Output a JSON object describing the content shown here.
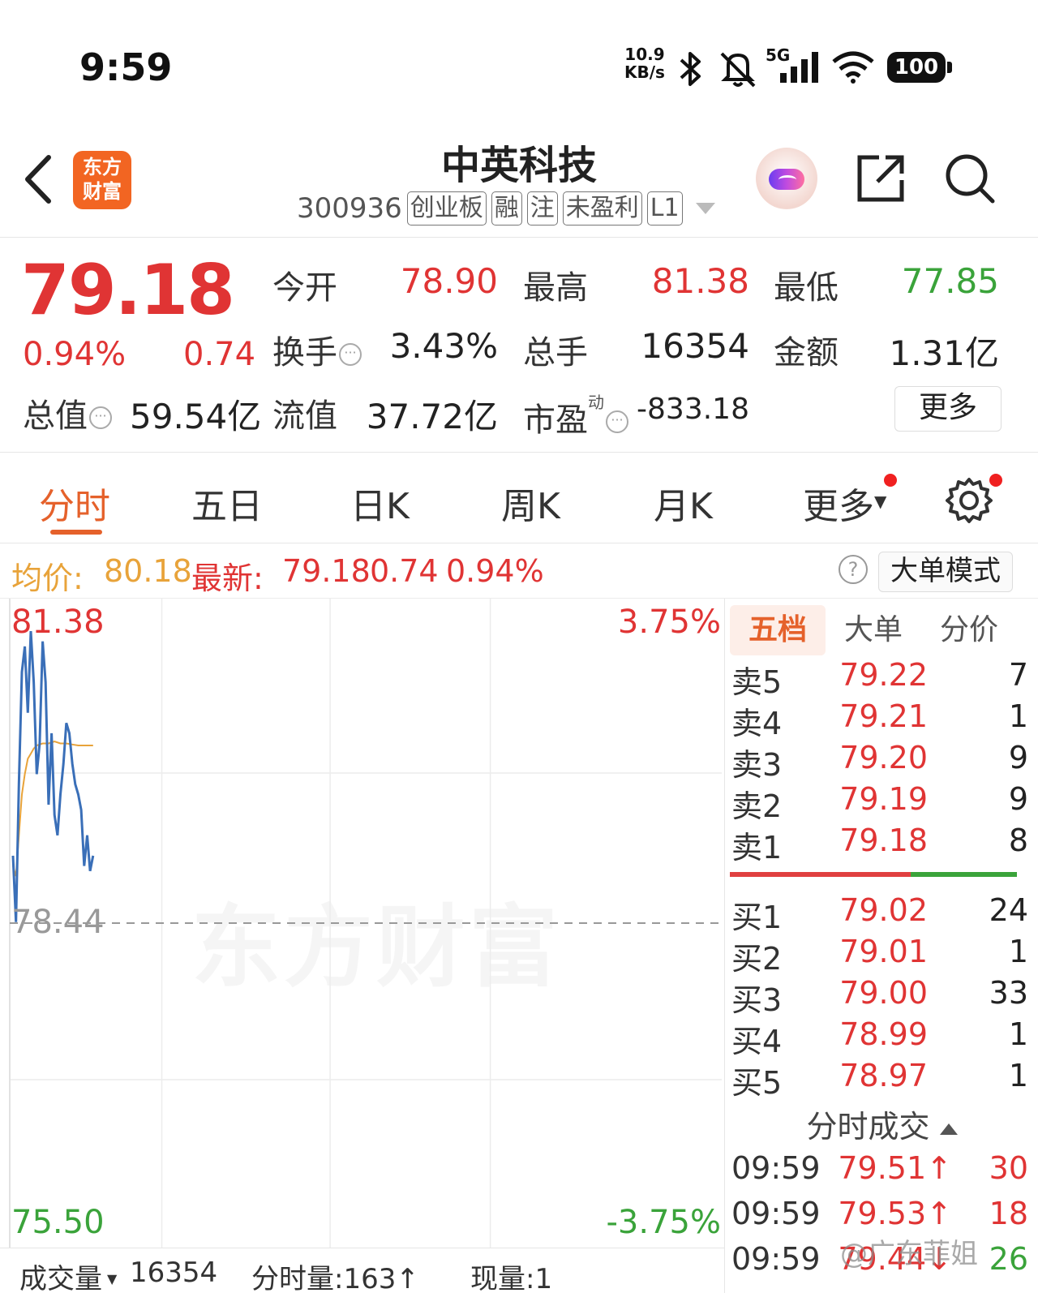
{
  "status_bar": {
    "time": "9:59",
    "net_speed_value": "10.9",
    "net_speed_unit": "KB/s",
    "network": "5G",
    "battery": "100",
    "icons": [
      "bluetooth-icon",
      "mute-icon",
      "signal-icon",
      "wifi-icon",
      "battery-icon"
    ]
  },
  "header": {
    "logo_line1": "东方",
    "logo_line2": "财富",
    "stock_name": "中英科技",
    "stock_code": "300936",
    "tags": [
      "创业板",
      "融",
      "注",
      "未盈利",
      "L1"
    ]
  },
  "quote": {
    "last_price": "79.18",
    "pct_change": "0.94%",
    "abs_change": "0.74",
    "open_label": "今开",
    "open_value": "78.90",
    "high_label": "最高",
    "high_value": "81.38",
    "low_label": "最低",
    "low_value": "77.85",
    "turnover_label": "换手",
    "turnover_value": "3.43%",
    "volume_label": "总手",
    "volume_value": "16354",
    "amount_label": "金额",
    "amount_value": "1.31亿",
    "mktcap_label": "总值",
    "mktcap_value": "59.54亿",
    "float_label": "流值",
    "float_value": "37.72亿",
    "pe_label": "市盈",
    "pe_sup": "动",
    "pe_value": "-833.18",
    "more_button": "更多"
  },
  "tabs": [
    "分时",
    "五日",
    "日K",
    "周K",
    "月K",
    "更多"
  ],
  "info_row": {
    "avg_label": "均价:",
    "avg_value": "80.18",
    "latest_label": "最新:",
    "latest_value": "79.18",
    "latest_change": "0.74",
    "latest_pct": "0.94%",
    "help": "?",
    "big_order_button": "大单模式"
  },
  "chart_data": {
    "type": "line",
    "title": "",
    "y_axis_left": {
      "max": "81.38",
      "mid": "78.44",
      "min": "75.50"
    },
    "y_axis_right": {
      "max": "3.75%",
      "min": "-3.75%"
    },
    "ylim": [
      75.5,
      81.38
    ],
    "reference_close": 78.44,
    "x_total_minutes": 240,
    "watermark": "东方财富",
    "series": [
      {
        "type": "price",
        "color": "#3a6fb8",
        "x": [
          0,
          1,
          2,
          3,
          4,
          5,
          6,
          7,
          8,
          9,
          10,
          11,
          12,
          13,
          14,
          15,
          16,
          17,
          18,
          19,
          20,
          21,
          22,
          23,
          24,
          25,
          26,
          27
        ],
        "values": [
          79.1,
          78.45,
          79.8,
          80.9,
          81.15,
          80.5,
          81.3,
          80.8,
          79.9,
          80.2,
          81.2,
          80.8,
          79.6,
          80.3,
          79.5,
          79.3,
          79.7,
          80.0,
          80.4,
          80.3,
          80.0,
          79.8,
          79.7,
          79.55,
          79.0,
          79.3,
          78.95,
          79.1
        ]
      },
      {
        "type": "average",
        "color": "#e8a33a",
        "x": [
          0,
          1,
          2,
          3,
          4,
          5,
          6,
          7,
          8,
          10,
          12,
          14,
          16,
          18,
          20,
          22,
          24,
          27
        ],
        "values": [
          79.0,
          78.9,
          79.3,
          79.7,
          79.9,
          80.05,
          80.1,
          80.15,
          80.18,
          80.2,
          80.2,
          80.22,
          80.2,
          80.2,
          80.19,
          80.18,
          80.18,
          80.18
        ]
      }
    ]
  },
  "depth": {
    "tabs": [
      "五档",
      "大单",
      "分价"
    ],
    "asks": [
      {
        "label": "卖5",
        "price": "79.22",
        "vol": "7"
      },
      {
        "label": "卖4",
        "price": "79.21",
        "vol": "1"
      },
      {
        "label": "卖3",
        "price": "79.20",
        "vol": "9"
      },
      {
        "label": "卖2",
        "price": "79.19",
        "vol": "9"
      },
      {
        "label": "卖1",
        "price": "79.18",
        "vol": "8"
      }
    ],
    "bids": [
      {
        "label": "买1",
        "price": "79.02",
        "vol": "24"
      },
      {
        "label": "买2",
        "price": "79.01",
        "vol": "1"
      },
      {
        "label": "买3",
        "price": "79.00",
        "vol": "33"
      },
      {
        "label": "买4",
        "price": "78.99",
        "vol": "1"
      },
      {
        "label": "买5",
        "price": "78.97",
        "vol": "1"
      }
    ],
    "bid_ask_ratio": 0.63,
    "trades_title": "分时成交",
    "trades": [
      {
        "time": "09:59",
        "price": "79.51↑",
        "vol": "30"
      },
      {
        "time": "09:59",
        "price": "79.53↑",
        "vol": "18"
      },
      {
        "time": "09:59",
        "price": "79.44↓",
        "vol": "26"
      }
    ]
  },
  "bottom_bar": {
    "volume_label": "成交量",
    "volume_value": "16354",
    "minute_vol": "分时量:163↑",
    "current_vol": "现量:1"
  },
  "watermark_credit": "@广东菲姐",
  "colors": {
    "up": "#e03434",
    "down": "#3aa33a",
    "accent": "#e5612b",
    "avg": "#e8a33a",
    "price_line": "#3a6fb8"
  }
}
